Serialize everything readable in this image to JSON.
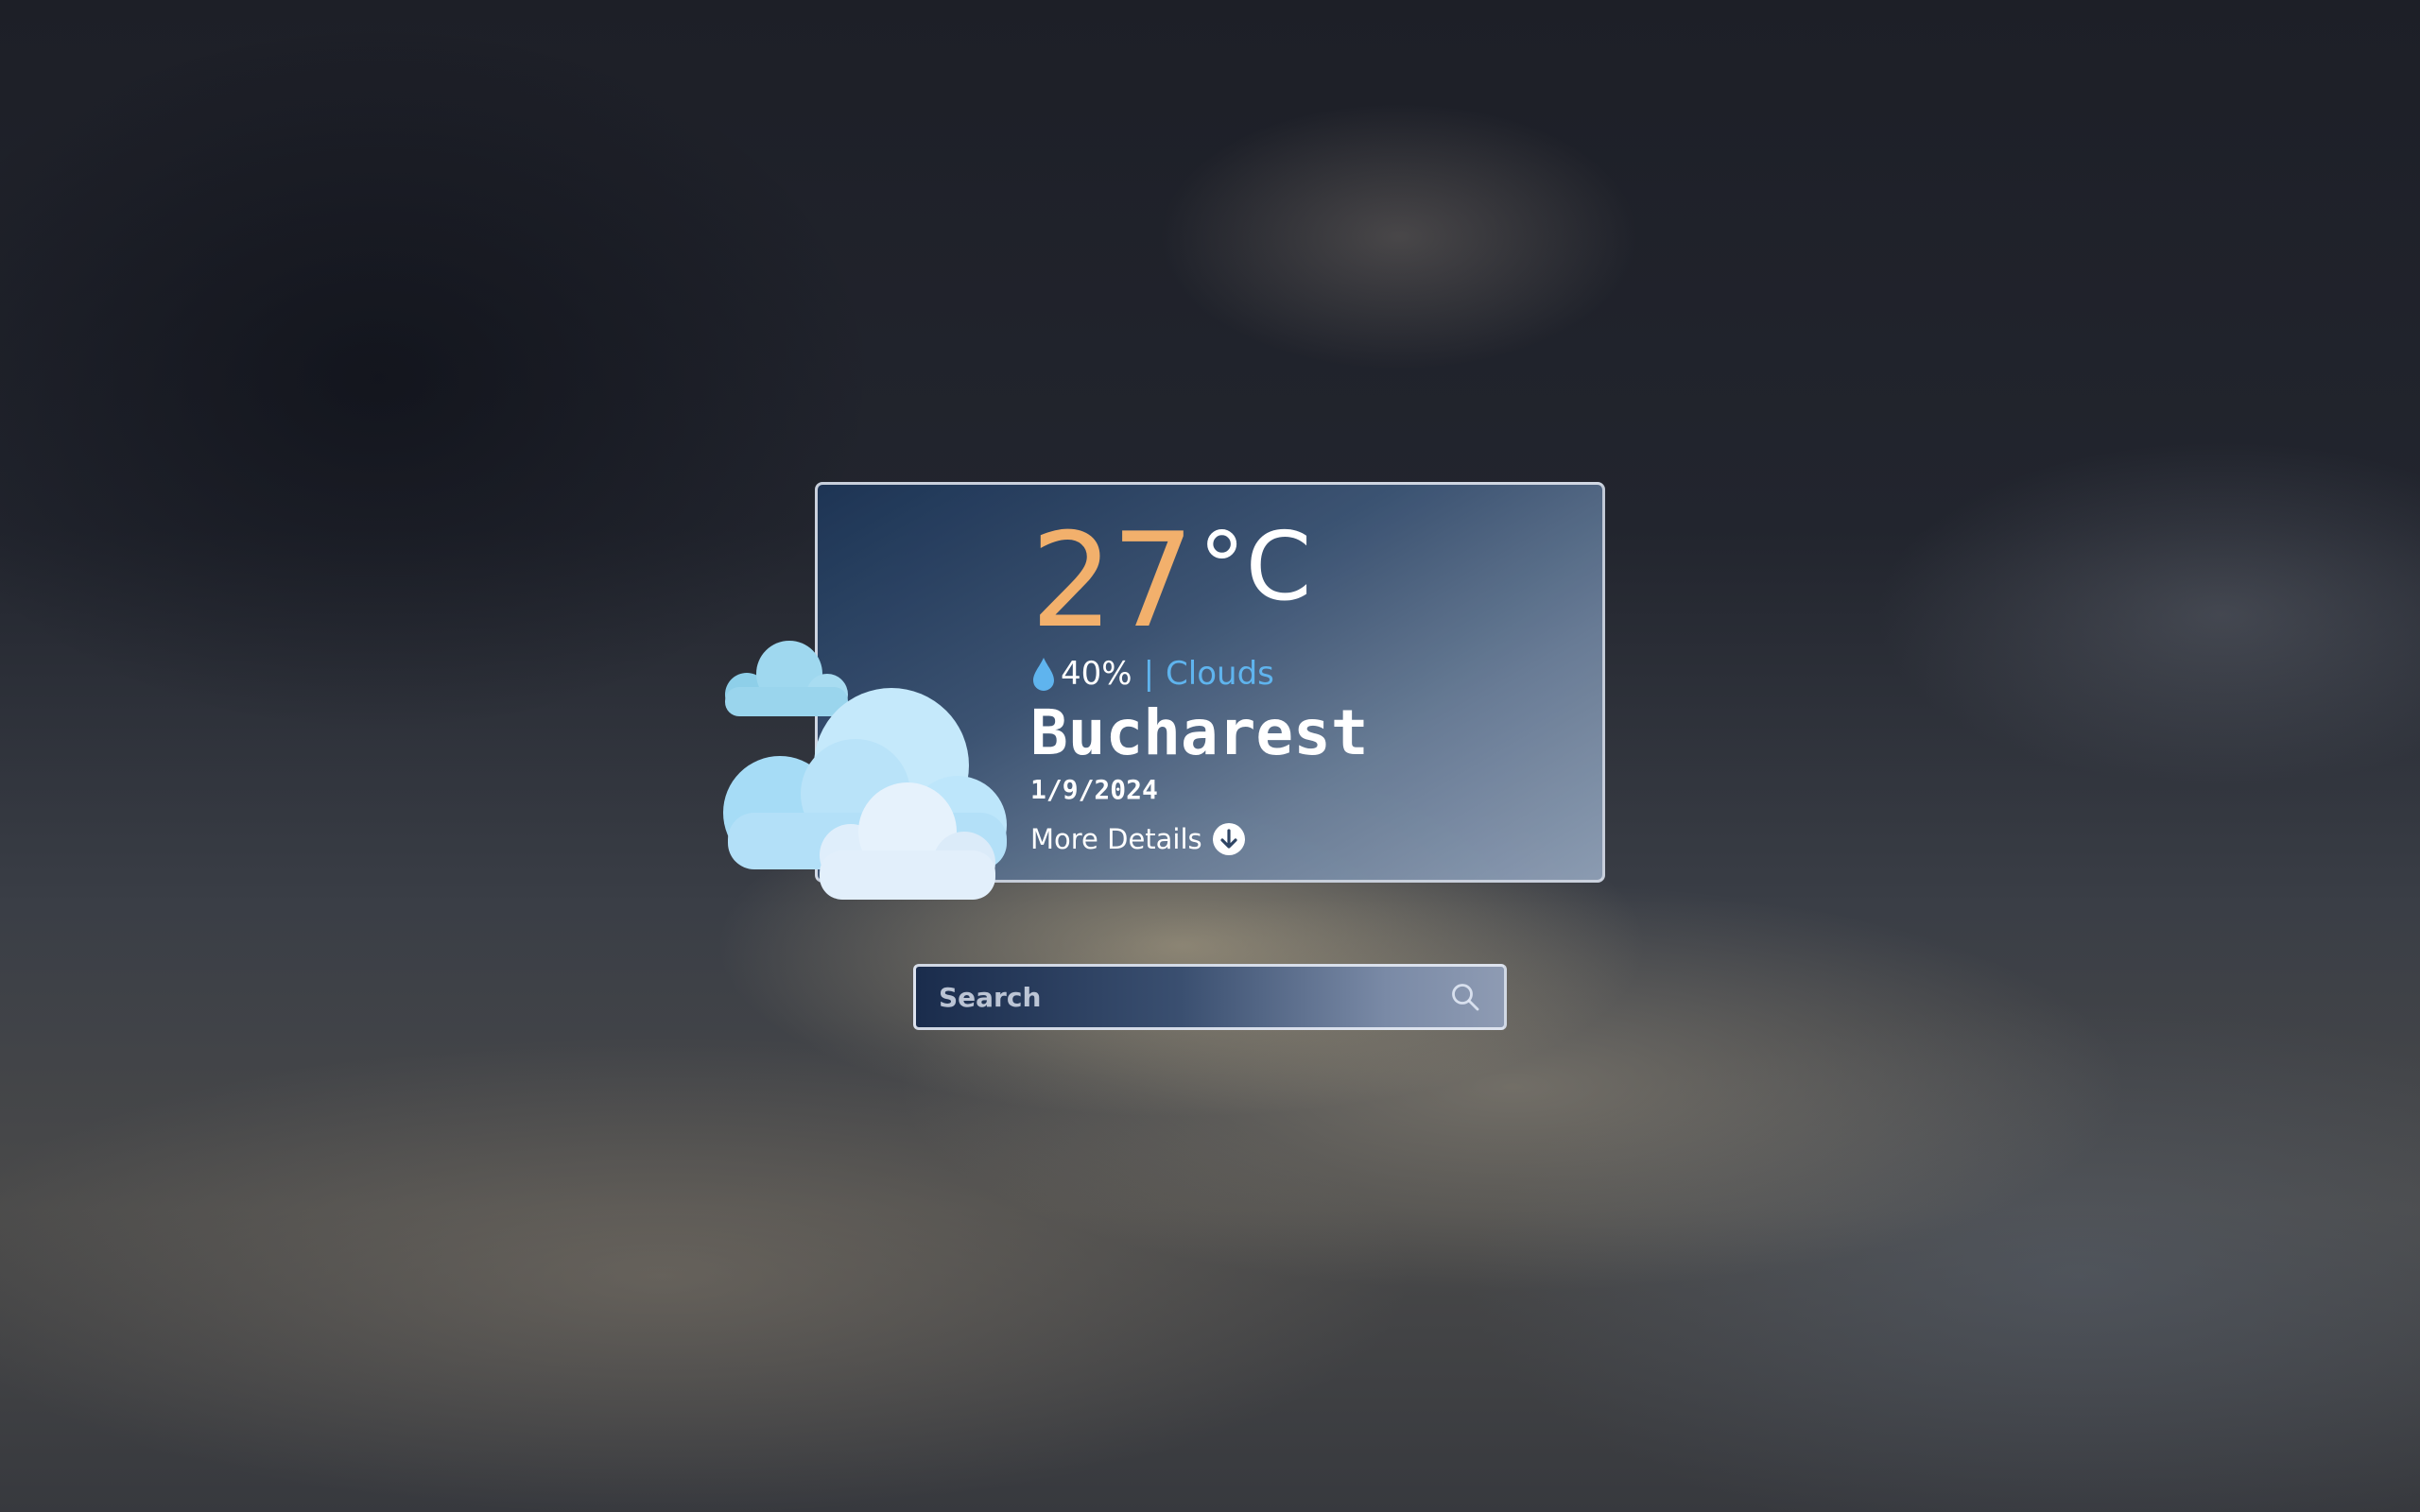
{
  "weather": {
    "temperature": "27",
    "unit": "°C",
    "humidity": "40%",
    "separator": "|",
    "condition": "Clouds",
    "city": "Bucharest",
    "date": "1/9/2024",
    "more_details_label": "More Details",
    "icon": "clouds-icon"
  },
  "search": {
    "placeholder": "Search",
    "value": ""
  },
  "colors": {
    "temperature": "#f2b06c",
    "condition": "#5fb4ee",
    "text": "#ffffff"
  }
}
